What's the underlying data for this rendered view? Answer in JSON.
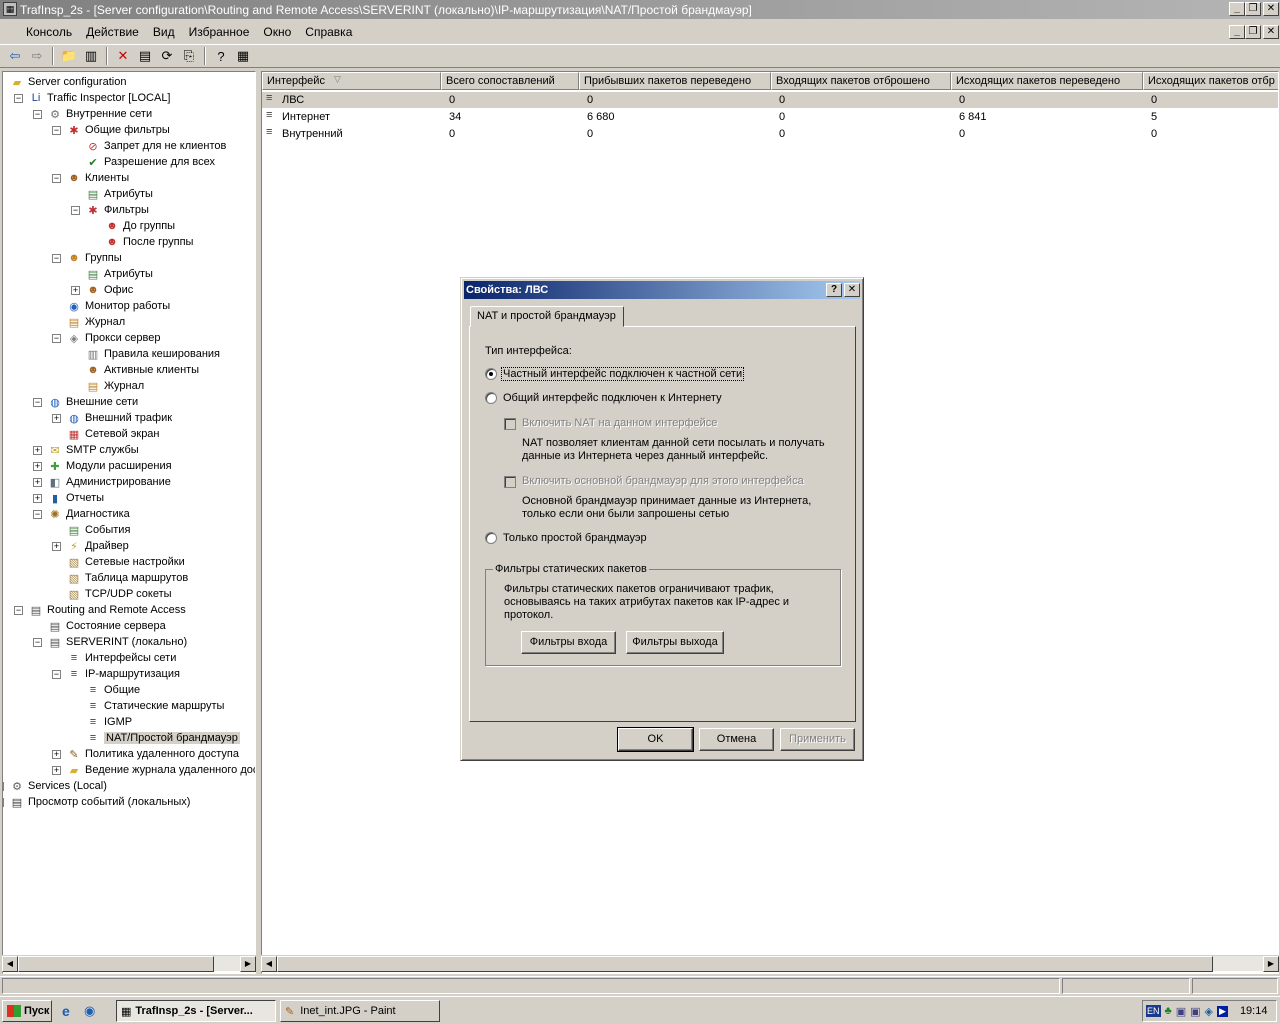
{
  "window": {
    "title": "TrafInsp_2s - [Server configuration\\Routing and Remote Access\\SERVERINT (локально)\\IP-маршрутизация\\NAT/Простой брандмауэр]"
  },
  "menu": [
    "Консоль",
    "Действие",
    "Вид",
    "Избранное",
    "Окно",
    "Справка"
  ],
  "tree": [
    {
      "label": "Server configuration",
      "icon": "folder-icon",
      "level": 0
    },
    {
      "label": "Traffic Inspector [LOCAL]",
      "icon": "app-icon",
      "level": 1,
      "exp": "-"
    },
    {
      "label": "Внутренние сети",
      "icon": "network-icon",
      "level": 2,
      "exp": "-"
    },
    {
      "label": "Общие фильтры",
      "icon": "filter-icon",
      "level": 3,
      "exp": "-"
    },
    {
      "label": "Запрет для не клиентов",
      "icon": "deny-icon",
      "level": 4
    },
    {
      "label": "Разрешение для всех",
      "icon": "allow-icon",
      "level": 4
    },
    {
      "label": "Клиенты",
      "icon": "user-icon",
      "level": 3,
      "exp": "-"
    },
    {
      "label": "Атрибуты",
      "icon": "doc-icon",
      "level": 4
    },
    {
      "label": "Фильтры",
      "icon": "filter-icon",
      "level": 4,
      "exp": "-"
    },
    {
      "label": "До группы",
      "icon": "filter-user-icon",
      "level": 5
    },
    {
      "label": "После группы",
      "icon": "filter-user-icon",
      "level": 5
    },
    {
      "label": "Группы",
      "icon": "group-icon",
      "level": 3,
      "exp": "-"
    },
    {
      "label": "Атрибуты",
      "icon": "doc-icon",
      "level": 4
    },
    {
      "label": "Офис",
      "icon": "user-icon",
      "level": 4,
      "exp": "+"
    },
    {
      "label": "Монитор работы",
      "icon": "monitor-icon",
      "level": 3
    },
    {
      "label": "Журнал",
      "icon": "log-icon",
      "level": 3
    },
    {
      "label": "Прокси сервер",
      "icon": "proxy-icon",
      "level": 3,
      "exp": "-"
    },
    {
      "label": "Правила кеширования",
      "icon": "trash-icon",
      "level": 4
    },
    {
      "label": "Активные клиенты",
      "icon": "user-icon",
      "level": 4
    },
    {
      "label": "Журнал",
      "icon": "log-icon",
      "level": 4
    },
    {
      "label": "Внешние сети",
      "icon": "globe-icon",
      "level": 2,
      "exp": "-"
    },
    {
      "label": "Внешний трафик",
      "icon": "globe-icon",
      "level": 3,
      "exp": "+"
    },
    {
      "label": "Сетевой экран",
      "icon": "firewall-icon",
      "level": 3
    },
    {
      "label": "SMTP службы",
      "icon": "mail-icon",
      "level": 2,
      "exp": "+"
    },
    {
      "label": "Модули расширения",
      "icon": "plugin-icon",
      "level": 2,
      "exp": "+"
    },
    {
      "label": "Администрирование",
      "icon": "admin-icon",
      "level": 2,
      "exp": "+"
    },
    {
      "label": "Отчеты",
      "icon": "report-icon",
      "level": 2,
      "exp": "+"
    },
    {
      "label": "Диагностика",
      "icon": "gear-icon",
      "level": 2,
      "exp": "-"
    },
    {
      "label": "События",
      "icon": "doc-icon",
      "level": 3
    },
    {
      "label": "Драйвер",
      "icon": "driver-icon",
      "level": 3,
      "exp": "+"
    },
    {
      "label": "Сетевые настройки",
      "icon": "settings-icon",
      "level": 3
    },
    {
      "label": "Таблица маршрутов",
      "icon": "settings-icon",
      "level": 3
    },
    {
      "label": "TCP/UDP сокеты",
      "icon": "settings-icon",
      "level": 3
    },
    {
      "label": "Routing and Remote Access",
      "icon": "server-icon",
      "level": 1,
      "exp": "-"
    },
    {
      "label": "Состояние сервера",
      "icon": "server-icon",
      "level": 2
    },
    {
      "label": "SERVERINT (локально)",
      "icon": "server-icon",
      "level": 2,
      "exp": "-"
    },
    {
      "label": "Интерфейсы сети",
      "icon": "interface-icon",
      "level": 3
    },
    {
      "label": "IP-маршрутизация",
      "icon": "interface-icon",
      "level": 3,
      "exp": "-"
    },
    {
      "label": "Общие",
      "icon": "interface-icon",
      "level": 4
    },
    {
      "label": "Статические маршруты",
      "icon": "interface-icon",
      "level": 4
    },
    {
      "label": "IGMP",
      "icon": "interface-icon",
      "level": 4
    },
    {
      "label": "NAT/Простой брандмауэр",
      "icon": "interface-icon",
      "level": 4,
      "selected": true
    },
    {
      "label": "Политика удаленного доступа",
      "icon": "policy-icon",
      "level": 3,
      "exp": "+"
    },
    {
      "label": "Ведение журнала удаленного дос",
      "icon": "folder-icon",
      "level": 3,
      "exp": "+"
    },
    {
      "label": "Services (Local)",
      "icon": "services-icon",
      "level": 0,
      "exp": "+"
    },
    {
      "label": "Просмотр событий (локальных)",
      "icon": "eventlog-icon",
      "level": 0,
      "exp": "+"
    }
  ],
  "list": {
    "columns": [
      "Интерфейс",
      "Всего сопоставлений",
      "Прибывших пакетов переведено",
      "Входящих пакетов отброшено",
      "Исходящих пакетов переведено",
      "Исходящих пакетов отбр"
    ],
    "rows": [
      [
        "ЛВС",
        "0",
        "0",
        "0",
        "0",
        "0"
      ],
      [
        "Интернет",
        "34",
        "6 680",
        "0",
        "6 841",
        "5"
      ],
      [
        "Внутренний",
        "0",
        "0",
        "0",
        "0",
        "0"
      ]
    ]
  },
  "dialog": {
    "title": "Свойства: ЛВС",
    "tab": "NAT и простой брандмауэр",
    "type_label": "Тип интерфейса:",
    "radio_private": "Частный интерфейс подключен к частной сети",
    "radio_public": "Общий интерфейс подключен к Интернету",
    "chk_nat": "Включить NAT на данном интерфейсе",
    "nat_desc1": "NAT позволяет клиентам данной сети посылать и получать",
    "nat_desc2": "данные из Интернета через данный интерфейс.",
    "chk_fw": "Включить основной брандмауэр для этого интерфейса",
    "fw_desc1": "Основной брандмауэр принимает данные из Интернета,",
    "fw_desc2": "только если они были запрошены сетью",
    "radio_fw_only": "Только простой брандмауэр",
    "group_title": "Фильтры статических пакетов",
    "group_desc1": "Фильтры статических пакетов ограничивают трафик,",
    "group_desc2": "основываясь на таких атрибутах пакетов как IP-адрес и",
    "group_desc3": "протокол.",
    "btn_in": "Фильтры входа",
    "btn_out": "Фильтры выхода",
    "btn_ok": "OK",
    "btn_cancel": "Отмена",
    "btn_apply": "Применить"
  },
  "taskbar": {
    "start": "Пуск",
    "tasks": [
      "TrafInsp_2s - [Server...",
      "Inet_int.JPG - Paint"
    ],
    "lang": "EN",
    "clock": "19:14"
  }
}
